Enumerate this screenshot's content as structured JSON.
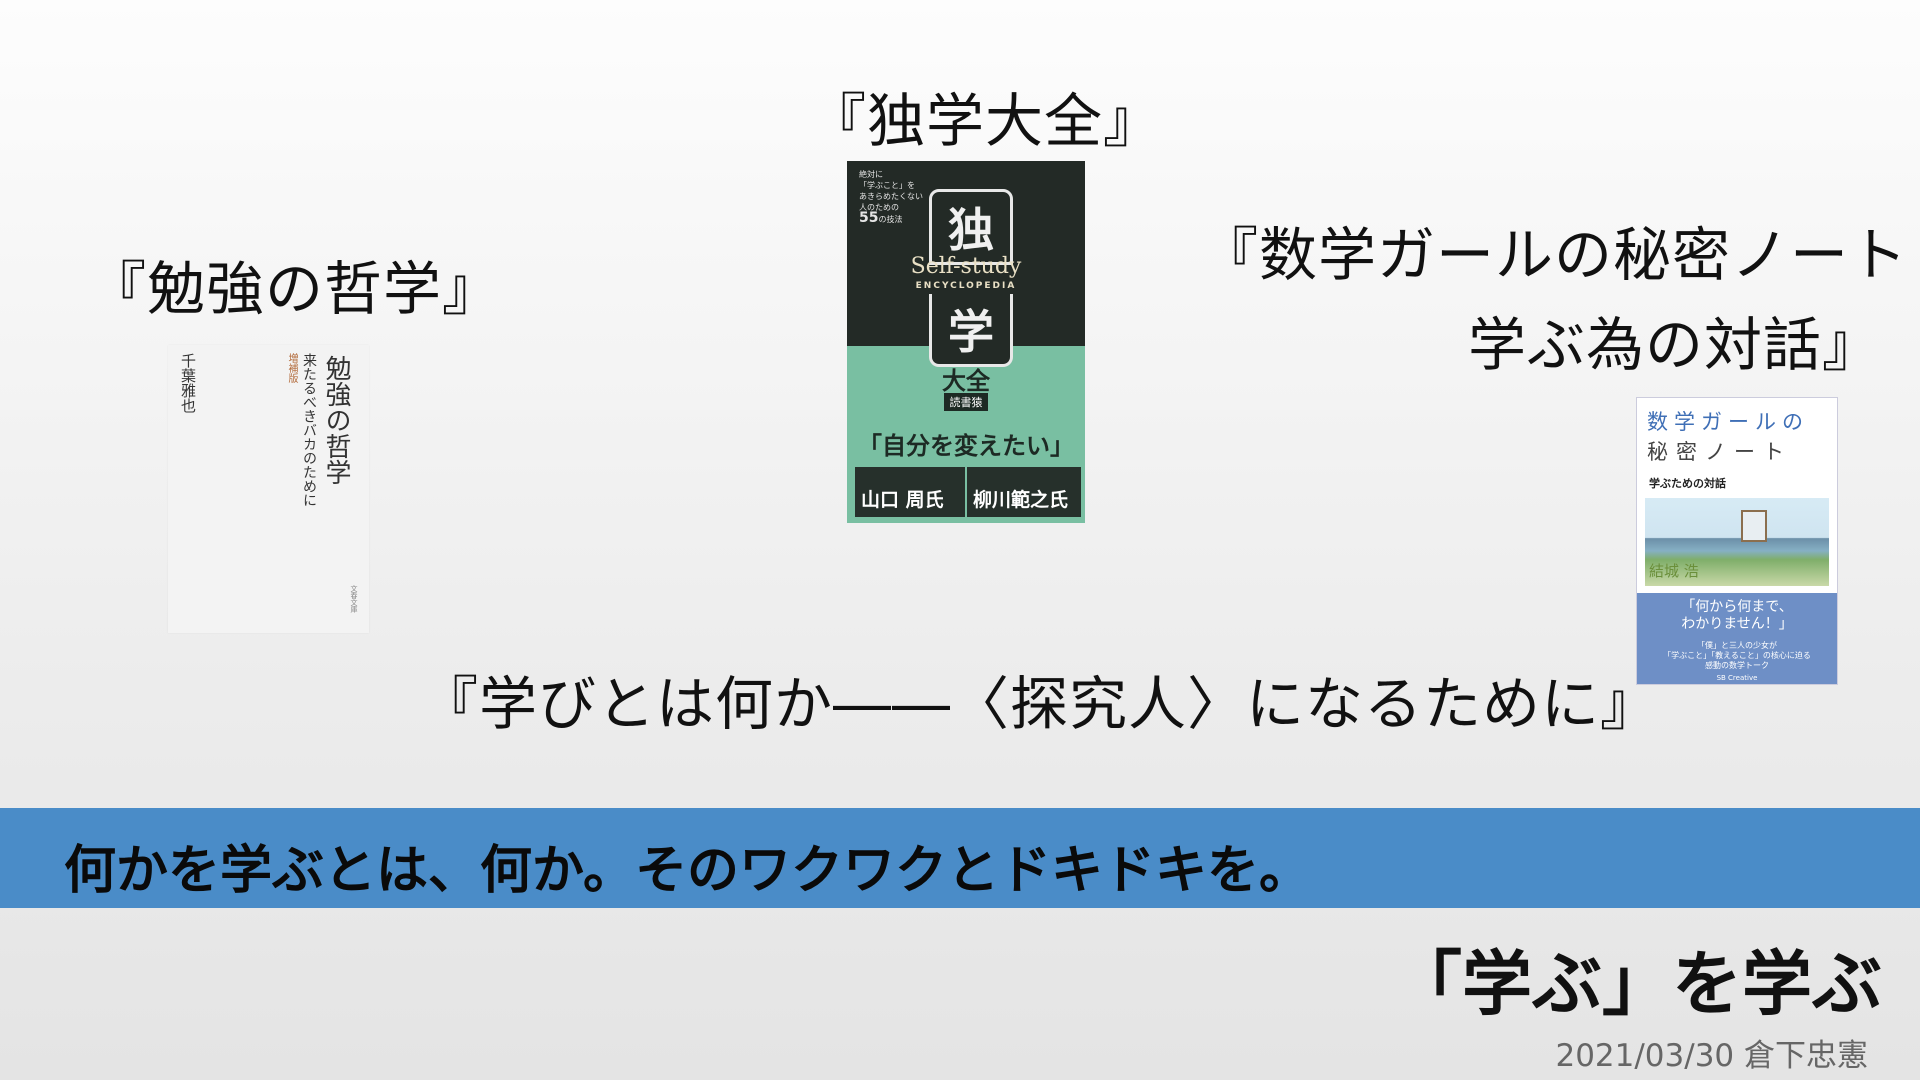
{
  "books": {
    "dokugaku": {
      "title": "『独学大全』",
      "cover": {
        "tag_line1": "絶対に",
        "tag_line2": "「学ぶこと」を",
        "tag_line3": "あきらめたくない",
        "tag_line4": "人のための",
        "tag_number": "55",
        "tag_suffix": "の技法",
        "kanji_top": "独",
        "kanji_bottom": "学",
        "en_title": "Self-study",
        "en_sub": "ENCYCLOPEDIA",
        "taizen": "大全",
        "author": "読書猿",
        "slogan": "「自分を変えたい」",
        "blurb_left": "山口 周氏",
        "blurb_right": "柳川範之氏"
      }
    },
    "benkyo": {
      "title": "『勉強の哲学』",
      "cover": {
        "title": "勉強の哲学",
        "subtitle": "来たるべきバカのために",
        "edition": "増補版",
        "author": "千葉雅也",
        "publisher": "文春文庫"
      }
    },
    "sugaku": {
      "title_line1": "『数学ガールの秘密ノート",
      "title_line2": "学ぶ為の対話』",
      "cover": {
        "title1": "数学ガールの",
        "title2": "秘密ノート",
        "subtitle": "学ぶための対話",
        "author": "結城 浩",
        "quote_line1": "「何から何まで、",
        "quote_line2": "わかりません！」",
        "desc_line1": "「僕」と三人の少女が",
        "desc_line2": "「学ぶこと」「教えること」の核心に迫る",
        "desc_line3": "感動の数学トーク",
        "publisher": "SB Creative"
      }
    },
    "manabi": {
      "title": "『学びとは何か――〈探究人〉になるために』"
    }
  },
  "banner": {
    "text": "何かを学ぶとは、何か。そのワクワクとドキドキを。"
  },
  "main_title": "「学ぶ」を学ぶ",
  "footer": "2021/03/30 倉下忠憲",
  "colors": {
    "banner_bg": "#4a8cc8",
    "dokugaku_green": "#79bfa2",
    "sugaku_blue": "#6e8fc6"
  }
}
